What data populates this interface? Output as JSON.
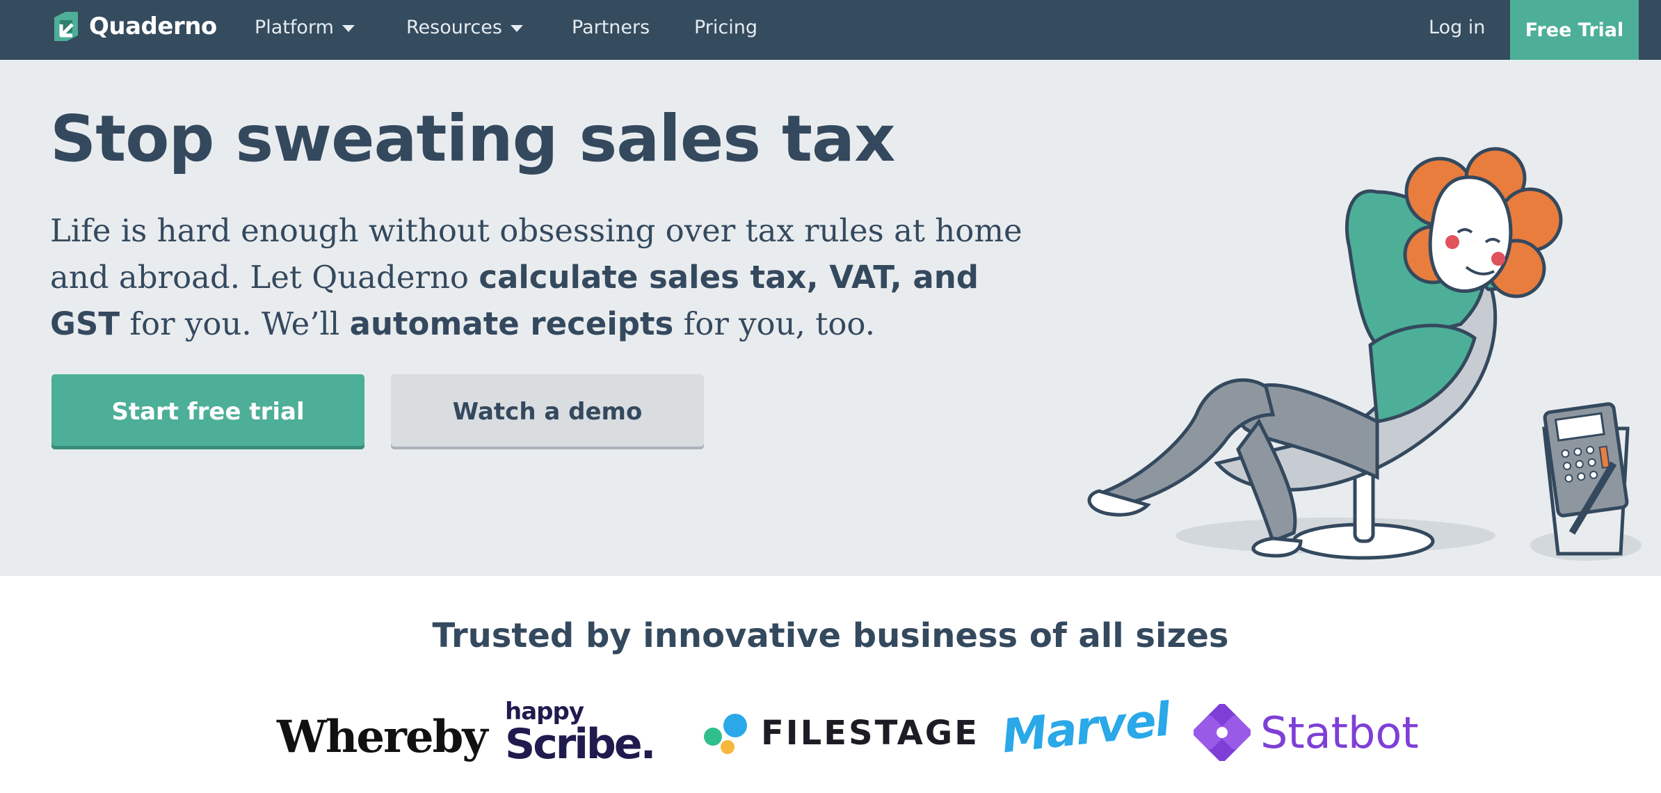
{
  "nav": {
    "brand": "Quaderno",
    "items": [
      {
        "label": "Platform",
        "dropdown": true
      },
      {
        "label": "Resources",
        "dropdown": true
      },
      {
        "label": "Partners",
        "dropdown": false
      },
      {
        "label": "Pricing",
        "dropdown": false
      }
    ],
    "login": "Log in",
    "cta": "Free Trial"
  },
  "hero": {
    "title": "Stop sweating sales tax",
    "subtitle": {
      "part1": "Life is hard enough without obsessing over tax rules at home and abroad. Let Quaderno ",
      "bold1": "calculate sales tax, VAT, and GST",
      "part2": " for you. We’ll ",
      "bold2": "automate receipts",
      "part3": " for you, too."
    },
    "primary_button": "Start free trial",
    "secondary_button": "Watch a demo"
  },
  "trusted": {
    "title": "Trusted by innovative business of all sizes",
    "logos": {
      "whereby": "Whereby",
      "happyscribe_top": "happy",
      "happyscribe_bottom": "Scribe.",
      "filestage": "FILESTAGE",
      "marvel": "Marvel",
      "statbot": "Statbot"
    }
  },
  "colors": {
    "nav_bg": "#354b5e",
    "accent": "#4daf98",
    "hero_bg": "#e9ecee",
    "text": "#34495e",
    "statbot_purple": "#7e3fd6",
    "marvel_blue": "#2aa8e8"
  },
  "icons": {
    "brand": "quaderno-logo-icon",
    "dropdown": "caret-down-icon",
    "hero_illustration": "relaxing-person-illustration",
    "statbot": "statbot-logo-icon"
  }
}
